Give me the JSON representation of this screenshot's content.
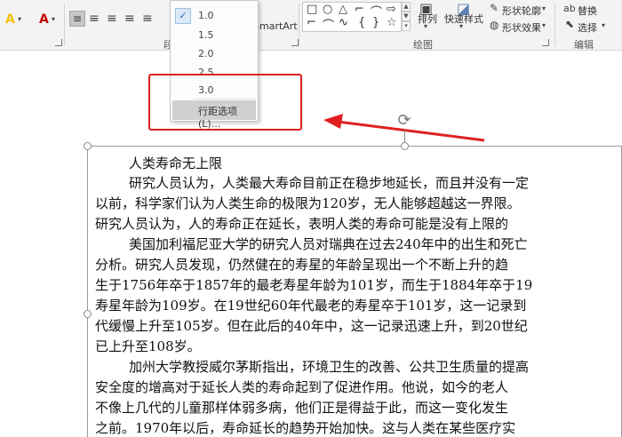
{
  "ribbon": {
    "groups": {
      "paragraph_partial": "段",
      "drawing": "绘图",
      "editing": "编辑"
    },
    "controls": {
      "smartart": "SmartArt",
      "arrange": "排列",
      "quick_styles": "快速样式",
      "shape_outline": "形状轮廓",
      "shape_effect": "形状效果",
      "replace": "替换",
      "select": "选择"
    },
    "icons": {
      "font_color": "A",
      "highlight": "A"
    }
  },
  "line_spacing_menu": {
    "options": [
      "1.0",
      "1.5",
      "2.0",
      "2.5",
      "3.0"
    ],
    "selected": "1.0",
    "more_options": "行距选项(L)..."
  },
  "document": {
    "lines": [
      "人类寿命无上限",
      "研究人员认为，人类最大寿命目前正在稳步地延长，而且并没有一定",
      "以前，科学家们认为人类生命的极限为120岁，无人能够超越这一界限。",
      "研究人员认为，人的寿命正在延长，表明人类的寿命可能是没有上限的",
      "美国加利福尼亚大学的研究人员对瑞典在过去240年中的出生和死亡",
      "分析。研究人员发现，仍然健在的寿星的年龄呈现出一个不断上升的趋",
      "生于1756年卒于1857年的最老寿星年龄为101岁，而生于1884年卒于19",
      "寿星年龄为109岁。在19世纪60年代最老的寿星卒于101岁，这一记录到",
      "代缓慢上升至105岁。但在此后的40年中，这一记录迅速上升，到20世纪",
      "已上升至108岁。",
      "加州大学教授威尔茅斯指出，环境卫生的改善、公共卫生质量的提高",
      "安全度的增高对于延长人类的寿命起到了促进作用。他说，如今的老人",
      "不像上几代的儿童那样体弱多病，他们正是得益于此，而这一变化发生",
      "之前。1970年以后，寿命延长的趋势开始加快。这与人类在某些医疗实"
    ]
  },
  "colors": {
    "highlight_border": "#e02020",
    "arrow": "#e02020",
    "selected_check": "#2b6cb0"
  }
}
